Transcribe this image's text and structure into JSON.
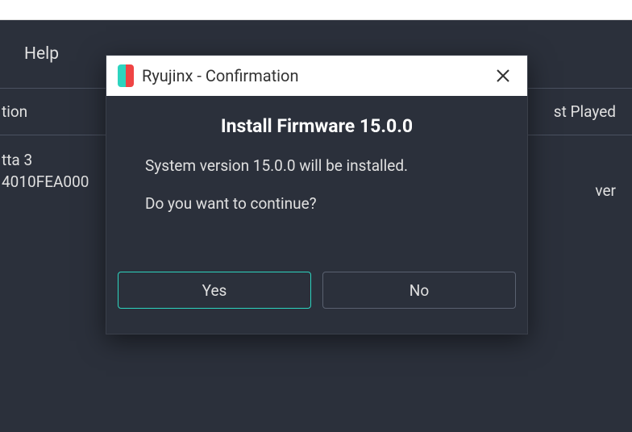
{
  "menubar": {
    "help": "Help"
  },
  "table": {
    "col_left": "tion",
    "col_right": "st Played",
    "row_line1": "tta 3",
    "row_line2": "4010FEA000",
    "row_right": "ver"
  },
  "dialog": {
    "title": "Ryujinx - Confirmation",
    "heading": "Install Firmware 15.0.0",
    "line1": "System version 15.0.0 will be installed.",
    "line2": "Do you want to continue?",
    "yes": "Yes",
    "no": "No"
  }
}
